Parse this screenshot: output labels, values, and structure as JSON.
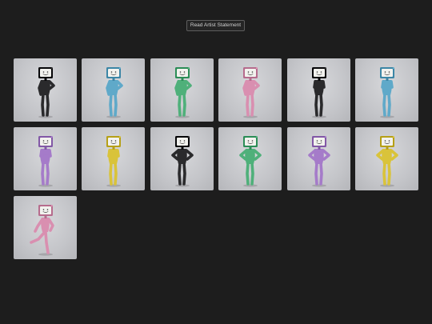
{
  "header": {
    "statement_button_label": "Read Artist Statement"
  },
  "gallery": {
    "tiles": [
      {
        "figure": "tv-head-figure",
        "color": "#2a2a2c",
        "screen": "#f2f2ee",
        "pose": "stand-hand-hip"
      },
      {
        "figure": "tv-head-figure",
        "color": "#5fa9c9",
        "screen": "#f2f2ee",
        "pose": "stand-hand-hip"
      },
      {
        "figure": "tv-head-figure",
        "color": "#4fb07a",
        "screen": "#f2f2ee",
        "pose": "stand-hand-hip"
      },
      {
        "figure": "tv-head-figure",
        "color": "#d98fb0",
        "screen": "#f2f2ee",
        "pose": "stand-hand-hip"
      },
      {
        "figure": "tv-head-figure",
        "color": "#2a2a2c",
        "screen": "#f2f2ee",
        "pose": "stand-arms-crossed"
      },
      {
        "figure": "tv-head-figure",
        "color": "#5fa9c9",
        "screen": "#f2f2ee",
        "pose": "stand-arms-crossed"
      },
      {
        "figure": "tv-head-figure",
        "color": "#a57bc9",
        "screen": "#f2f2ee",
        "pose": "stand-arms-crossed"
      },
      {
        "figure": "tv-head-figure",
        "color": "#d9c33a",
        "screen": "#f2f2ee",
        "pose": "stand-arms-crossed"
      },
      {
        "figure": "tv-head-figure",
        "color": "#2a2a2c",
        "screen": "#f2f2ee",
        "pose": "hands-on-hips"
      },
      {
        "figure": "tv-head-figure",
        "color": "#4fb07a",
        "screen": "#f2f2ee",
        "pose": "hands-on-hips"
      },
      {
        "figure": "tv-head-figure",
        "color": "#a57bc9",
        "screen": "#f2f2ee",
        "pose": "hands-on-hips"
      },
      {
        "figure": "tv-head-figure",
        "color": "#d9c33a",
        "screen": "#f2f2ee",
        "pose": "hands-on-hips"
      },
      {
        "figure": "tv-head-figure",
        "color": "#d98fb0",
        "screen": "#f2f2ee",
        "pose": "kick"
      }
    ]
  }
}
